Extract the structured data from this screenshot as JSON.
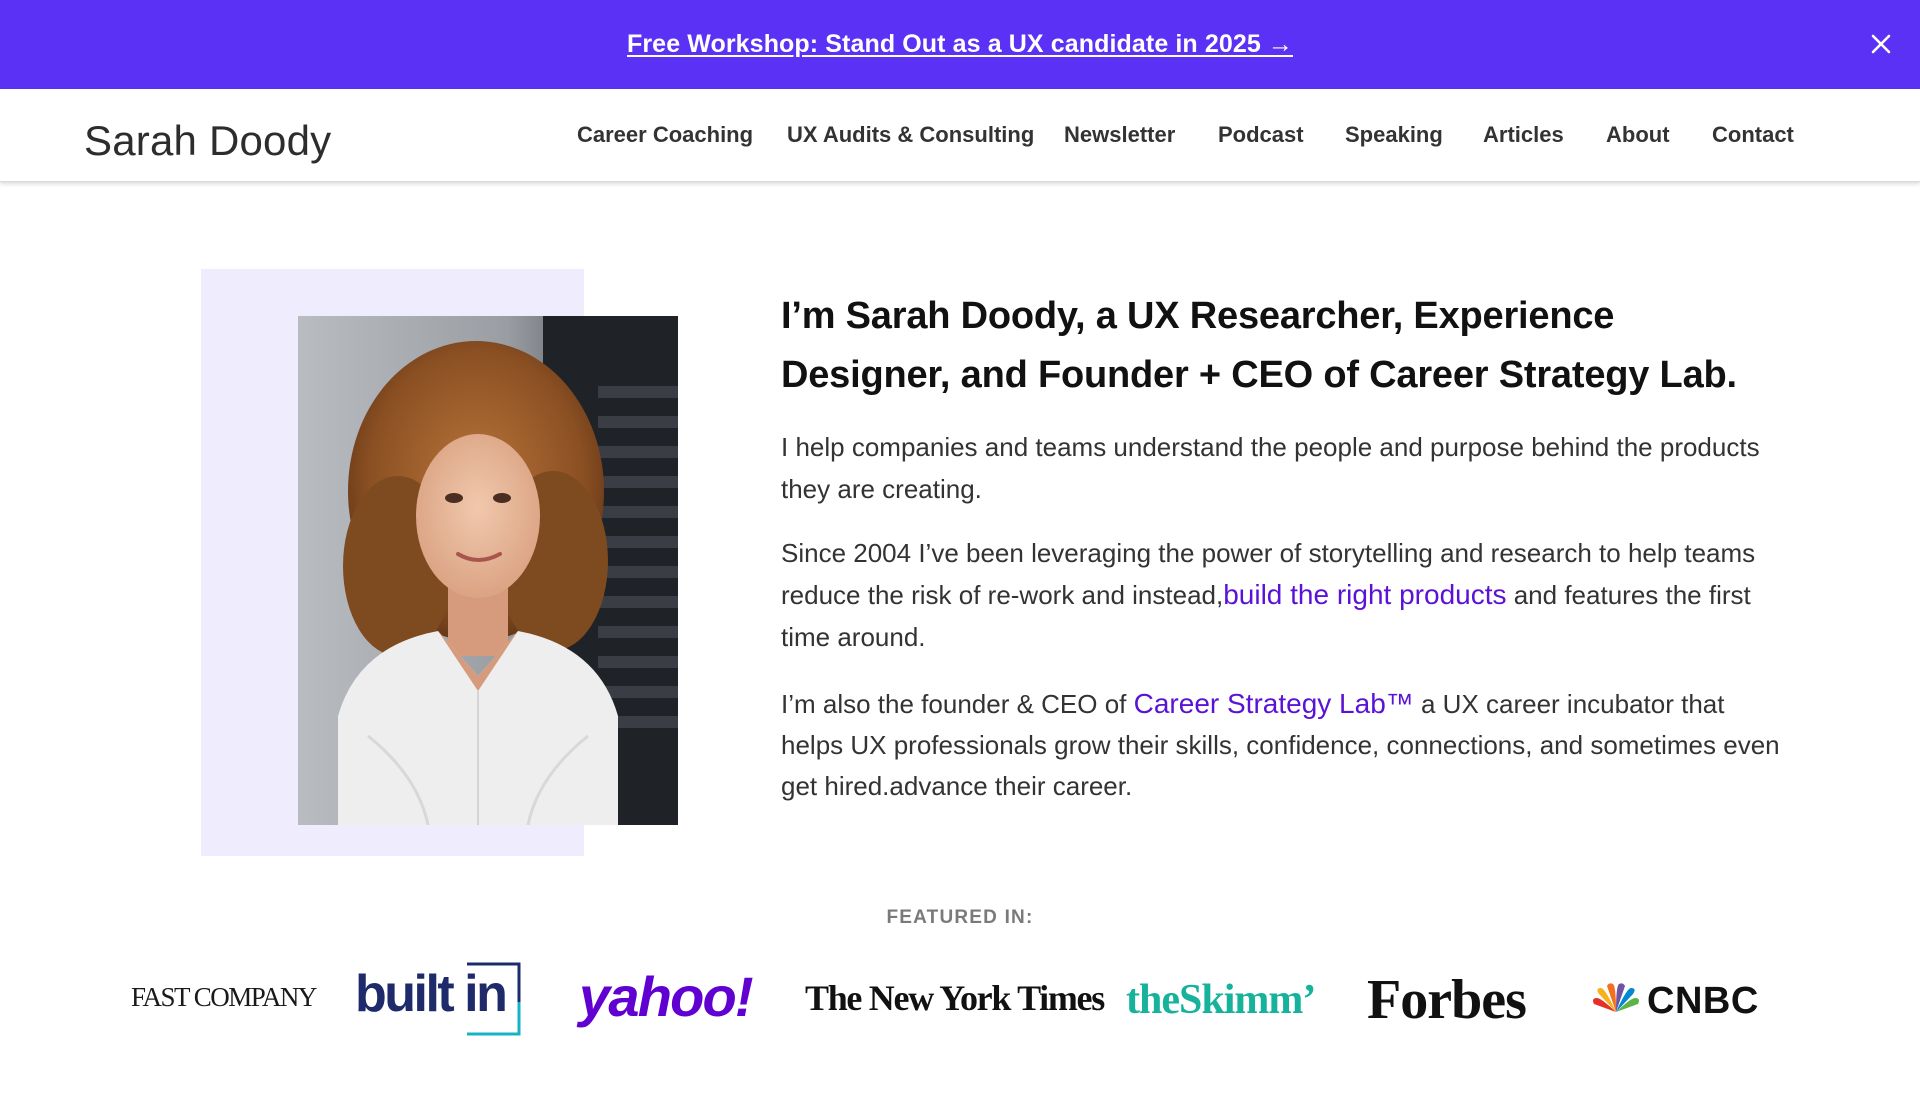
{
  "announcement": {
    "text": "Free Workshop: Stand Out as a UX candidate in 2025 →",
    "close_icon": "close-icon"
  },
  "header": {
    "logo": "Sarah Doody",
    "nav": [
      {
        "label": "Career Coaching"
      },
      {
        "label": "UX Audits & Consulting"
      },
      {
        "label": "Newsletter"
      },
      {
        "label": "Podcast"
      },
      {
        "label": "Speaking"
      },
      {
        "label": "Articles"
      },
      {
        "label": "About"
      },
      {
        "label": "Contact"
      }
    ]
  },
  "hero": {
    "title_line1": "I’m Sarah Doody, a UX Researcher,  Experience",
    "title_line2": "Designer, and Founder + CEO of Career Strategy Lab.",
    "p1": "I help companies and teams understand the people and purpose behind the products they are creating.",
    "p2_before": "Since 2004 I’ve been leveraging the power of storytelling and research to help teams reduce the risk of re-work and instead,",
    "p2_link": "build the right products",
    "p2_after": " and features the first time around.",
    "p3_before": "I’m also the founder & CEO of ",
    "p3_link": "Career Strategy Lab™",
    "p3_after": " a UX career incubator that helps UX professionals grow their skills, confidence, connections, and sometimes even get hired.advance their career."
  },
  "featured": {
    "label": "FEATURED IN:",
    "logos": [
      {
        "name": "Fast Company",
        "text": "FAST COMPANY"
      },
      {
        "name": "Built In",
        "text": "built in"
      },
      {
        "name": "Yahoo",
        "text": "yahoo!"
      },
      {
        "name": "The New York Times",
        "text": "The New York Times"
      },
      {
        "name": "theSkimm",
        "text": "theSkimm’"
      },
      {
        "name": "Forbes",
        "text": "Forbes"
      },
      {
        "name": "CNBC",
        "text": "CNBC"
      }
    ]
  },
  "colors": {
    "brand_purple": "#5b32f5",
    "link_purple": "#5a13d6",
    "photo_backdrop": "#efecfd"
  }
}
